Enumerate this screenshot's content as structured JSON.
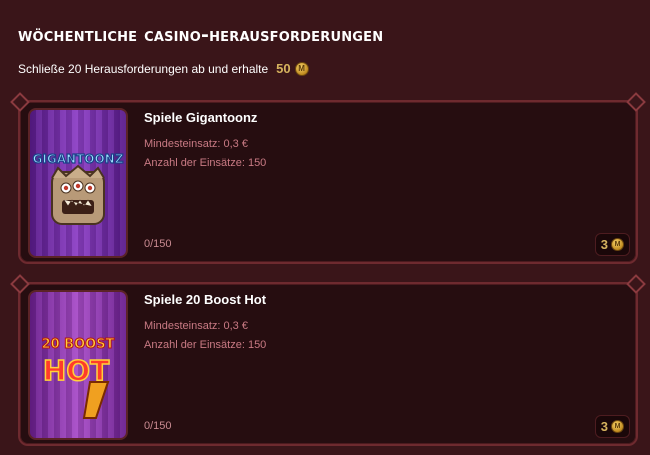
{
  "header": {
    "title": "Wöchentliche Casino-Herausforderungen",
    "subtitle": "Schließe 20 Herausforderungen ab und erhalte",
    "reward_total": "50",
    "coin_icon": "coin-icon"
  },
  "challenges": [
    {
      "title": "Spiele Gigantoonz",
      "min_bet": "Mindesteinsatz: 0,3 €",
      "bet_count": "Anzahl der Einsätze: 150",
      "progress": "0/150",
      "reward": "3",
      "thumb_label": "GIGANTOONZ"
    },
    {
      "title": "Spiele 20 Boost Hot",
      "min_bet": "Mindesteinsatz: 0,3 €",
      "bet_count": "Anzahl der Einsätze: 150",
      "progress": "0/150",
      "reward": "3",
      "thumb_label": "20 BOOST HOT"
    }
  ],
  "colors": {
    "background": "#3a1519",
    "card": "#260d10",
    "accent_gold": "#d6b35e",
    "meta_text": "#c97a84"
  }
}
